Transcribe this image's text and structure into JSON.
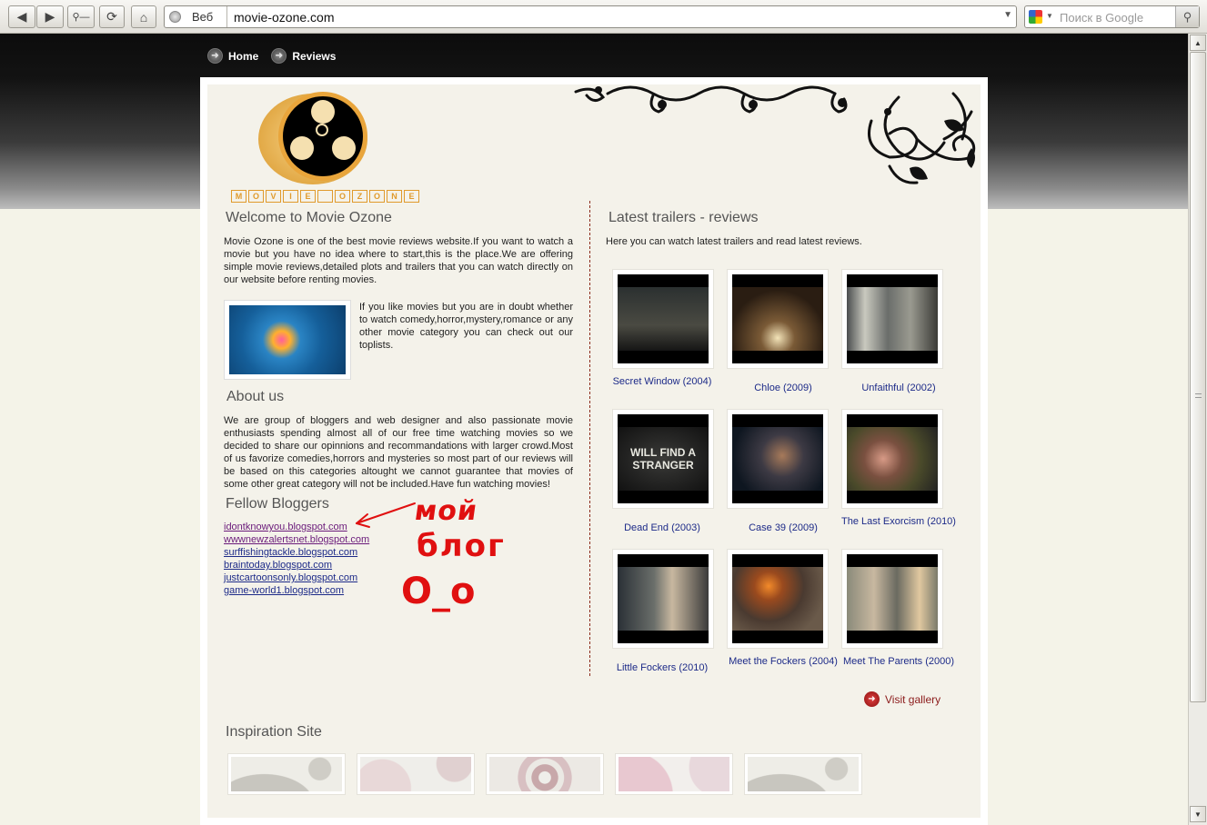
{
  "browser": {
    "web_label": "Веб",
    "url": "movie-ozone.com",
    "search_placeholder": "Поиск в Google"
  },
  "nav": [
    {
      "label": "Home"
    },
    {
      "label": "Reviews"
    }
  ],
  "logo": {
    "letters": [
      "M",
      "O",
      "V",
      "I",
      "E",
      "",
      "O",
      "Z",
      "O",
      "N",
      "E"
    ]
  },
  "welcome": {
    "title": "Welcome to Movie Ozone",
    "text": "Movie Ozone is one of the best movie reviews website.If you want to watch a movie but you have no idea where to start,this is the place.We are offering simple movie reviews,detailed plots and trailers that you can watch directly on our website before renting movies.",
    "side_text": "If you like movies but you are in doubt whether to watch comedy,horror,mystery,romance or any other movie category you can check out our toplists."
  },
  "about": {
    "title": "About us",
    "text": "We are group of bloggers and web designer and also passionate movie enthusiasts spending almost all of our free time watching movies so we decided to share our opinnions and recommandations with larger crowd.Most of us favorize comedies,horrors and mysteries so most part of our reviews will be based on this categories altought we cannot guarantee that movies of some other great category will not be included.Have fun watching movies!"
  },
  "bloggers": {
    "title": "Fellow Bloggers",
    "links": [
      {
        "label": "idontknowyou.blogspot.com",
        "visited": true
      },
      {
        "label": "wwwnewzalertsnet.blogspot.com",
        "visited": true
      },
      {
        "label": "surffishingtackle.blogspot.com",
        "visited": false
      },
      {
        "label": "braintoday.blogspot.com",
        "visited": false
      },
      {
        "label": "justcartoonsonly.blogspot.com",
        "visited": false
      },
      {
        "label": "game-world1.blogspot.com",
        "visited": false
      }
    ]
  },
  "annotation": {
    "line1": "мой",
    "line2": "блог",
    "line3": "O_o"
  },
  "trailers": {
    "title": "Latest trailers - reviews",
    "intro": "Here you can watch latest trailers and read latest reviews.",
    "items": [
      {
        "label": "Secret Window (2004)"
      },
      {
        "label": "Chloe (2009)"
      },
      {
        "label": "Unfaithful (2002)"
      },
      {
        "label": "Dead End (2003)",
        "overlay": "WILL FIND A STRANGER"
      },
      {
        "label": "Case 39 (2009)"
      },
      {
        "label": "The Last Exorcism (2010)"
      },
      {
        "label": "Little Fockers (2010)"
      },
      {
        "label": "Meet the Fockers (2004)"
      },
      {
        "label": "Meet The Parents (2000)"
      }
    ],
    "visit_label": "Visit gallery"
  },
  "inspiration": {
    "title": "Inspiration Site"
  },
  "colors": {
    "accent": "#1c2a88",
    "visited": "#6a1a7a",
    "annotation": "#e01010",
    "logo_orange": "#e09a2c"
  }
}
